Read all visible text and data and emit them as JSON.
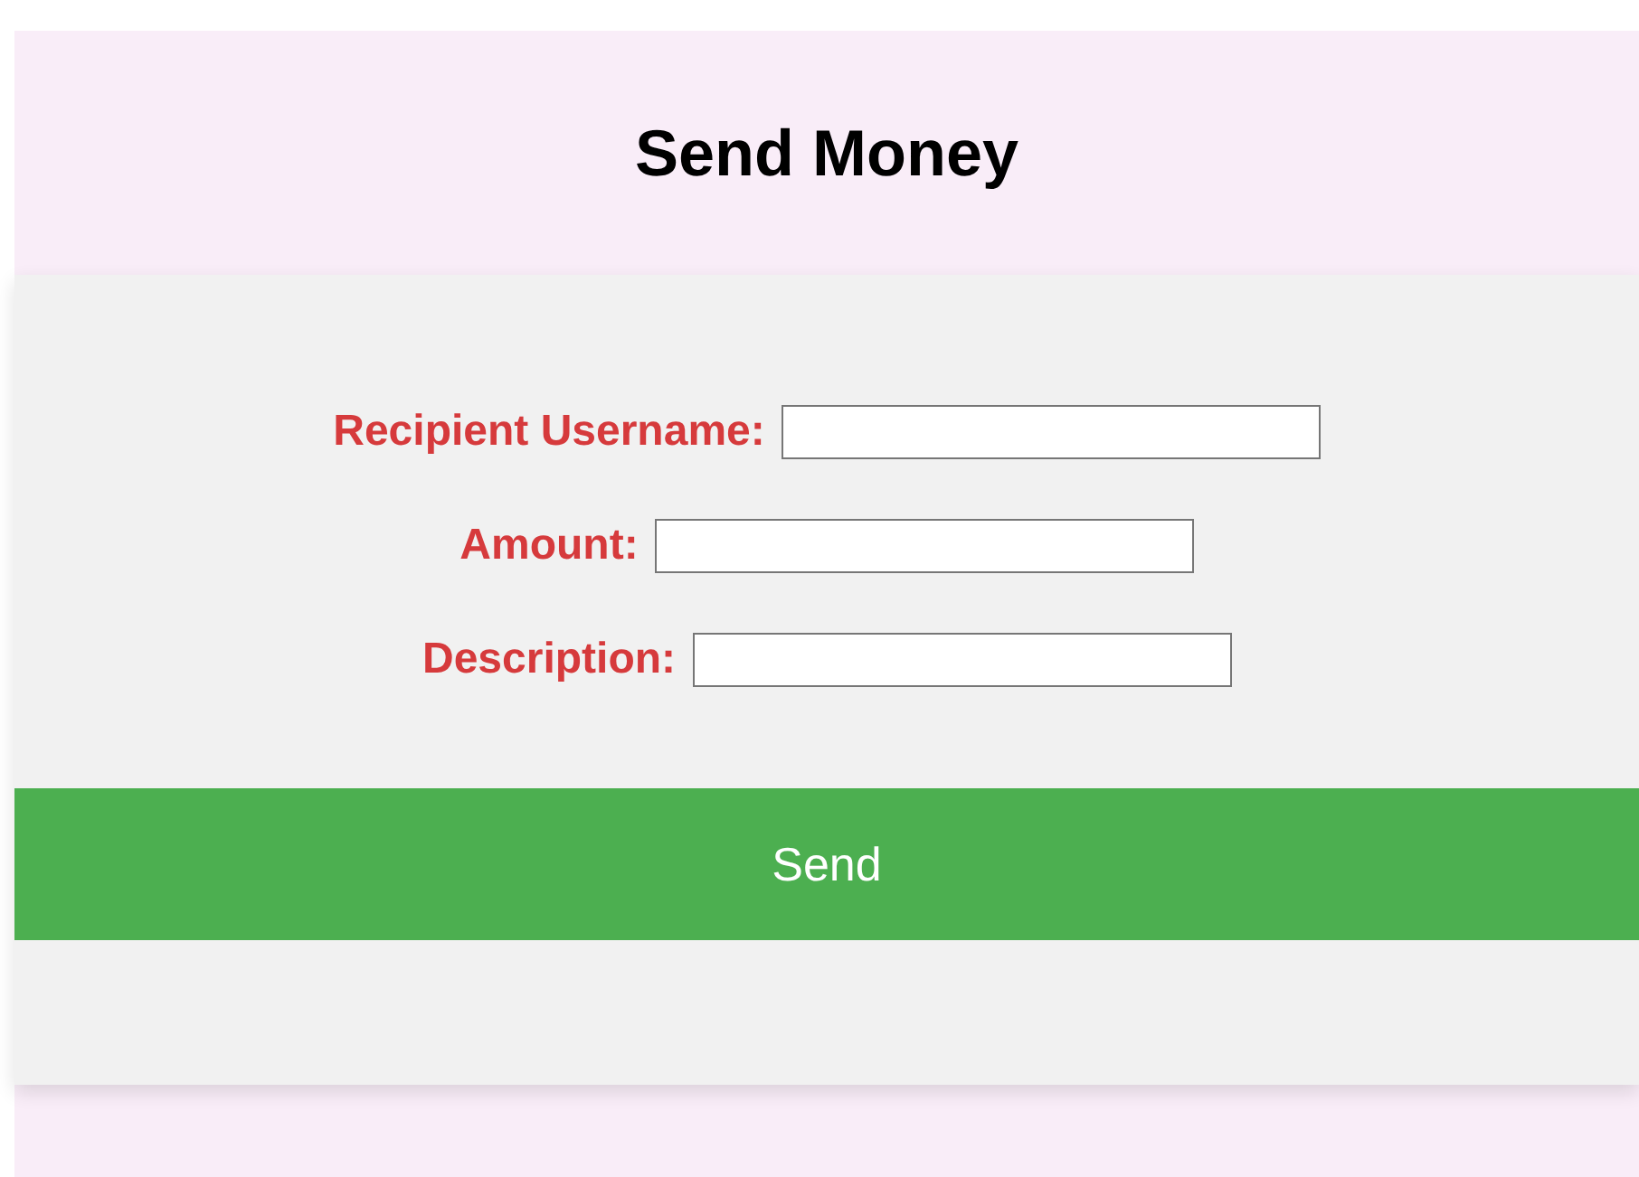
{
  "title": "Send Money",
  "fields": [
    {
      "label": "Recipient Username:"
    },
    {
      "label": "Amount:"
    },
    {
      "label": "Description:"
    }
  ],
  "button": "Send"
}
